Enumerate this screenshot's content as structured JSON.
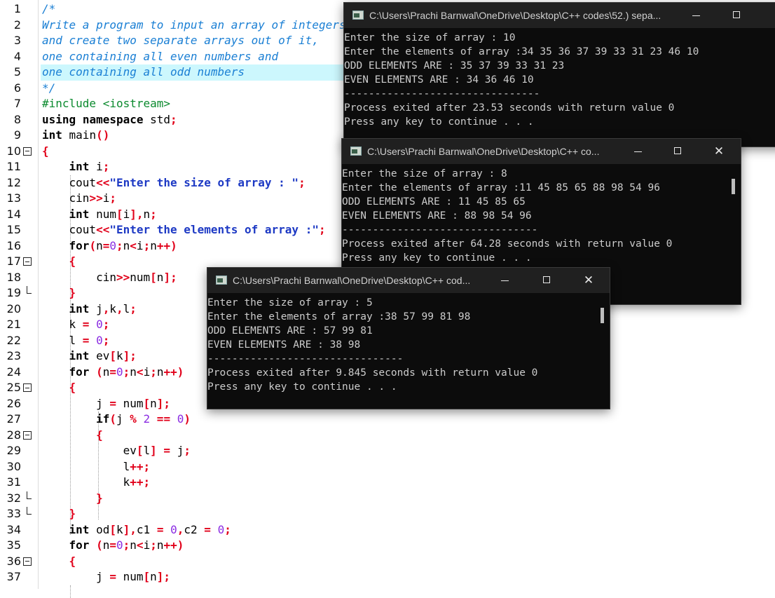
{
  "editor": {
    "line_numbers": [
      "1",
      "2",
      "3",
      "4",
      "5",
      "6",
      "7",
      "8",
      "9",
      "10",
      "11",
      "12",
      "13",
      "14",
      "15",
      "16",
      "17",
      "18",
      "19",
      "20",
      "21",
      "22",
      "23",
      "24",
      "25",
      "26",
      "27",
      "28",
      "29",
      "30",
      "31",
      "32",
      "33",
      "34",
      "35",
      "36",
      "37"
    ],
    "code": [
      "/*",
      "Write a program to input an array of integers",
      "and create two separate arrays out of it,",
      "one containing all even numbers and",
      "one containing all odd numbers",
      "*/",
      "#include <iostream>",
      "using namespace std;",
      "int main()",
      "{",
      "    int i;",
      "    cout<<\"Enter the size of array : \";",
      "    cin>>i;",
      "    int num[i],n;",
      "    cout<<\"Enter the elements of array :\";",
      "    for(n=0;n<i;n++)",
      "    {",
      "        cin>>num[n];",
      "    }",
      "    int j,k,l;",
      "    k = 0;",
      "    l = 0;",
      "    int ev[k];",
      "    for (n=0;n<i;n++)",
      "    {",
      "        j = num[n];",
      "        if(j % 2 == 0)",
      "        {",
      "            ev[l] = j;",
      "            l++;",
      "            k++;",
      "        }",
      "    }",
      "    int od[k],c1 = 0,c2 = 0;",
      "    for (n=0;n<i;n++)",
      "    {",
      "        j = num[n];"
    ],
    "highlighted_line": 5
  },
  "consoles": [
    {
      "title": "C:\\Users\\Prachi Barnwal\\OneDrive\\Desktop\\C++ codes\\52.) sepa...",
      "lines": [
        "Enter the size of array : 10",
        "Enter the elements of array :34 35 36 37 39 33 31 23 46 10",
        "ODD ELEMENTS ARE : 35 37 39 33 31 23",
        "EVEN ELEMENTS ARE : 34 36 46 10",
        "--------------------------------",
        "Process exited after 23.53 seconds with return value 0",
        "Press any key to continue . . ."
      ]
    },
    {
      "title": "C:\\Users\\Prachi Barnwal\\OneDrive\\Desktop\\C++ co...",
      "lines": [
        "Enter the size of array : 8",
        "Enter the elements of array :11 45 85 65 88 98 54 96",
        "ODD ELEMENTS ARE : 11 45 85 65",
        "EVEN ELEMENTS ARE : 88 98 54 96",
        "--------------------------------",
        "Process exited after 64.28 seconds with return value 0",
        "Press any key to continue . . ."
      ]
    },
    {
      "title": "C:\\Users\\Prachi Barnwal\\OneDrive\\Desktop\\C++ cod...",
      "lines": [
        "Enter the size of array : 5",
        "Enter the elements of array :38 57 99 81 98",
        "ODD ELEMENTS ARE : 57 99 81",
        "EVEN ELEMENTS ARE : 38 98",
        "--------------------------------",
        "Process exited after 9.845 seconds with return value 0",
        "Press any key to continue . . ."
      ]
    }
  ],
  "window_buttons": {
    "minimize": "—",
    "maximize": "☐",
    "close": "✕"
  },
  "colors": {
    "comment": "#1a7fd4",
    "preprocessor": "#0b8a2e",
    "operator": "#e1001a",
    "string": "#1d39c4",
    "number": "#8a2be2",
    "line_highlight": "#ccf7fd",
    "console_bg": "#0c0c0c",
    "console_text": "#cccccc"
  }
}
